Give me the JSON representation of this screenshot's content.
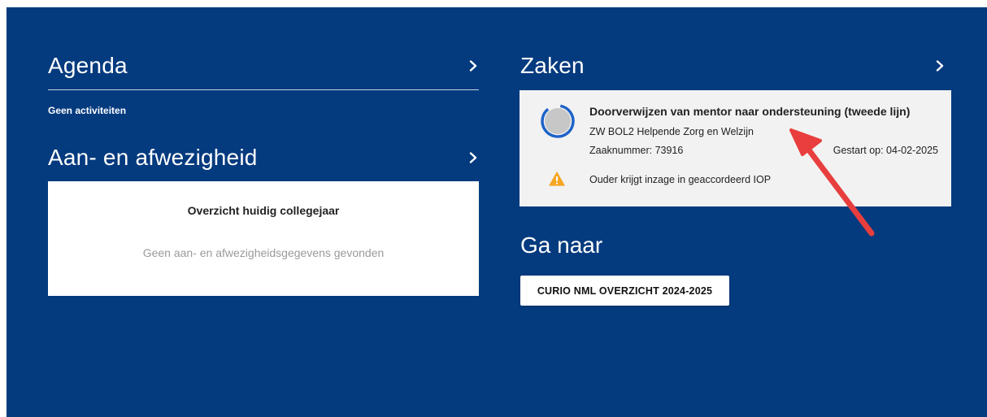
{
  "agenda": {
    "title": "Agenda",
    "empty_text": "Geen activiteiten"
  },
  "aanwezigheid": {
    "title": "Aan- en afwezigheid",
    "card_title": "Overzicht huidig collegejaar",
    "empty_text": "Geen aan- en afwezigheidsgegevens gevonden"
  },
  "zaken": {
    "title": "Zaken",
    "item": {
      "title": "Doorverwijzen van mentor naar ondersteuning (tweede lijn)",
      "subtitle": "ZW BOL2 Helpende Zorg en Welzijn",
      "zaaknummer": "Zaaknummer: 73916",
      "gestart": "Gestart op: 04-02-2025",
      "warning": "Ouder krijgt inzage in geaccordeerd IOP"
    }
  },
  "ga_naar": {
    "title": "Ga naar",
    "button_label": "CURIO NML OVERZICHT 2024-2025"
  },
  "colors": {
    "background": "#043A7E",
    "card": "#FFFFFF",
    "zaak_card": "#F2F2F2",
    "progress_ring": "#1E63C8",
    "warning": "#F5A623",
    "annotation_arrow": "#E83E3E"
  },
  "icons": [
    "chevron-right-icon",
    "progress-ring-icon",
    "warning-icon",
    "annotation-arrow"
  ]
}
